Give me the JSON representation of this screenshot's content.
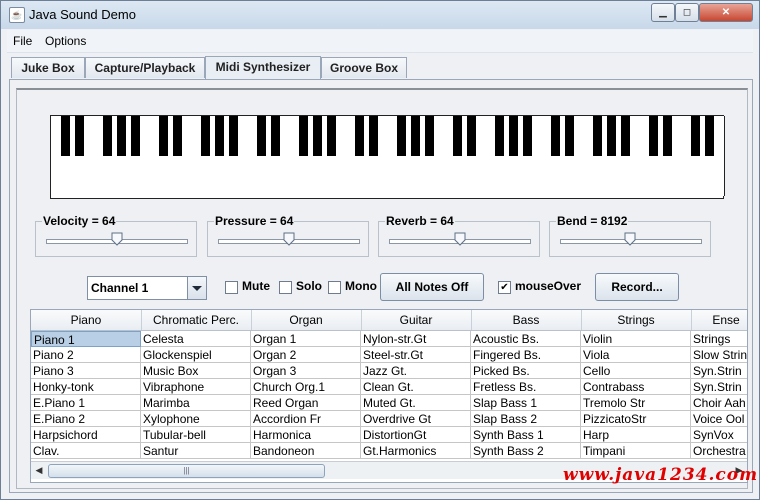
{
  "window": {
    "title": "Java Sound Demo"
  },
  "menubar": {
    "items": [
      "File",
      "Options"
    ]
  },
  "tabs": [
    {
      "label": "Juke Box",
      "active": false
    },
    {
      "label": "Capture/Playback",
      "active": false
    },
    {
      "label": "Midi Synthesizer",
      "active": true
    },
    {
      "label": "Groove Box",
      "active": false
    }
  ],
  "sliders": [
    {
      "label": "Velocity = 64",
      "value": 64,
      "max": 127
    },
    {
      "label": "Pressure = 64",
      "value": 64,
      "max": 127
    },
    {
      "label": "Reverb = 64",
      "value": 64,
      "max": 127
    },
    {
      "label": "Bend = 8192",
      "value": 8192,
      "max": 16383
    }
  ],
  "controls": {
    "channel_selected": "Channel 1",
    "mute_label": "Mute",
    "mute_checked": false,
    "solo_label": "Solo",
    "solo_checked": false,
    "mono_label": "Mono",
    "mono_checked": false,
    "all_notes_off_label": "All Notes Off",
    "mouseover_label": "mouseOver",
    "mouseover_checked": true,
    "record_label": "Record..."
  },
  "table": {
    "columns": [
      "Piano",
      "Chromatic Perc.",
      "Organ",
      "Guitar",
      "Bass",
      "Strings",
      "Ense"
    ],
    "rows": [
      [
        "Piano 1",
        "Celesta",
        "Organ 1",
        "Nylon-str.Gt",
        "Acoustic Bs.",
        "Violin",
        "Strings"
      ],
      [
        "Piano 2",
        "Glockenspiel",
        "Organ 2",
        "Steel-str.Gt",
        "Fingered Bs.",
        "Viola",
        "Slow Strin"
      ],
      [
        "Piano 3",
        "Music Box",
        "Organ 3",
        "Jazz Gt.",
        "Picked Bs.",
        "Cello",
        "Syn.Strin"
      ],
      [
        "Honky-tonk",
        "Vibraphone",
        "Church Org.1",
        "Clean Gt.",
        "Fretless Bs.",
        "Contrabass",
        "Syn.Strin"
      ],
      [
        "E.Piano 1",
        "Marimba",
        "Reed Organ",
        "Muted Gt.",
        "Slap Bass 1",
        "Tremolo Str",
        "Choir Aah"
      ],
      [
        "E.Piano 2",
        "Xylophone",
        "Accordion Fr",
        "Overdrive Gt",
        "Slap Bass 2",
        "PizzicatoStr",
        "Voice Ool"
      ],
      [
        "Harpsichord",
        "Tubular-bell",
        "Harmonica",
        "DistortionGt",
        "Synth Bass 1",
        "Harp",
        "SynVox"
      ],
      [
        "Clav.",
        "Santur",
        "Bandoneon",
        "Gt.Harmonics",
        "Synth Bass 2",
        "Timpani",
        "Orchestra"
      ]
    ],
    "selected": [
      0,
      0
    ]
  },
  "icons": {
    "scroll_left": "◀",
    "scroll_right": "▶",
    "grip": "|||",
    "combo_arrow": "▼",
    "check": "✔"
  },
  "watermark": "www.java1234.com",
  "colors": {
    "selection": "#b8cfe5",
    "watermark": "#e00000"
  }
}
